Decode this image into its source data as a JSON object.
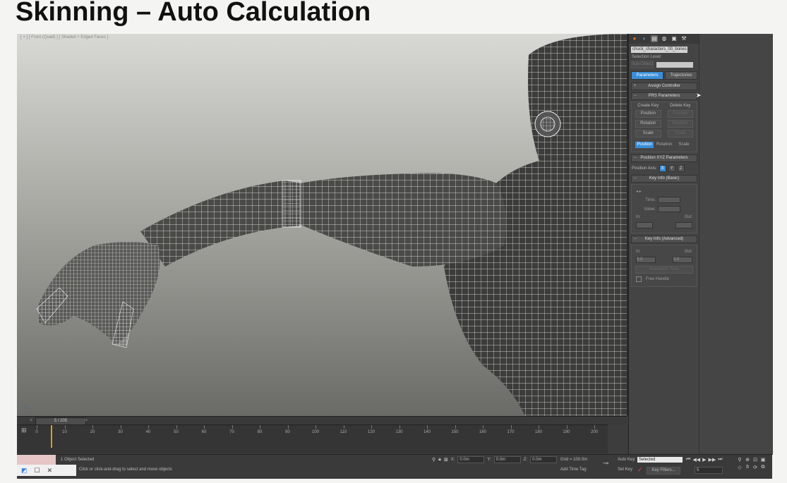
{
  "slide": {
    "title": "Skinning – Auto Calculation"
  },
  "viewport": {
    "label": "[ + ] [ Front (Quad) ] [ Shaded + Edged Faces ]",
    "axis_icon": "axis-tripod-icon"
  },
  "command_panel": {
    "tab_icons": [
      "create-icon",
      "modify-icon",
      "hierarchy-icon",
      "motion-icon",
      "display-icon",
      "utilities-icon"
    ],
    "object_name": "chuck_characters_00_bones",
    "selection_level_label": "Selection Level:",
    "sub_object_label": "Sub-Object",
    "tabs": [
      {
        "label": "Parameters",
        "active": true
      },
      {
        "label": "Trajectories",
        "active": false
      }
    ],
    "assign_controller": "Assign Controller",
    "prs_parameters": {
      "title": "PRS Parameters",
      "create_key_label": "Create Key",
      "delete_key_label": "Delete Key",
      "create_buttons": [
        "Position",
        "Rotation",
        "Scale"
      ],
      "delete_buttons": [
        "Position",
        "Rotation",
        "Scale"
      ],
      "tabs": [
        {
          "label": "Position",
          "active": true
        },
        {
          "label": "Rotation",
          "active": false
        },
        {
          "label": "Scale",
          "active": false
        }
      ]
    },
    "position_xyz": {
      "title": "Position XYZ Parameters",
      "axis_label": "Position Axis:",
      "axes": [
        {
          "label": "X",
          "active": true
        },
        {
          "label": "Y",
          "active": false
        },
        {
          "label": "Z",
          "active": false
        }
      ]
    },
    "key_info_basic": {
      "title": "Key Info (Basic)",
      "time_label": "Time:",
      "value_label": "Value:",
      "in_label": "In:",
      "out_label": "Out:"
    },
    "key_info_advanced": {
      "title": "Key Info (Advanced)",
      "in_label": "In:",
      "out_label": "Out:",
      "in_value": "0.0",
      "out_value": "0.0",
      "normalize_label": "Normalize Time",
      "free_handle_label": "Free Handle"
    }
  },
  "time_slider": {
    "value": "5 / 205",
    "prev": "<",
    "next": ">"
  },
  "trackbar": {
    "ticks": [
      "0",
      "10",
      "20",
      "30",
      "40",
      "50",
      "60",
      "70",
      "80",
      "90",
      "100",
      "110",
      "120",
      "130",
      "140",
      "150",
      "160",
      "170",
      "180",
      "190",
      "200"
    ],
    "current_frame": 5
  },
  "status": {
    "objects_selected": "1 Object Selected",
    "prompt": "Click or click-and-drag to select and move objects",
    "x_label": "X:",
    "x_value": "0.0m",
    "y_label": "Y:",
    "y_value": "0.0m",
    "z_label": "Z:",
    "z_value": "0.0m",
    "grid": "Grid = 100.0m",
    "add_time_tag": "Add Time Tag",
    "auto_key": "Auto Key",
    "set_key": "Set Key",
    "selected_dropdown": "Selected",
    "key_filters": "Key Filters...",
    "frame_value": "5"
  }
}
